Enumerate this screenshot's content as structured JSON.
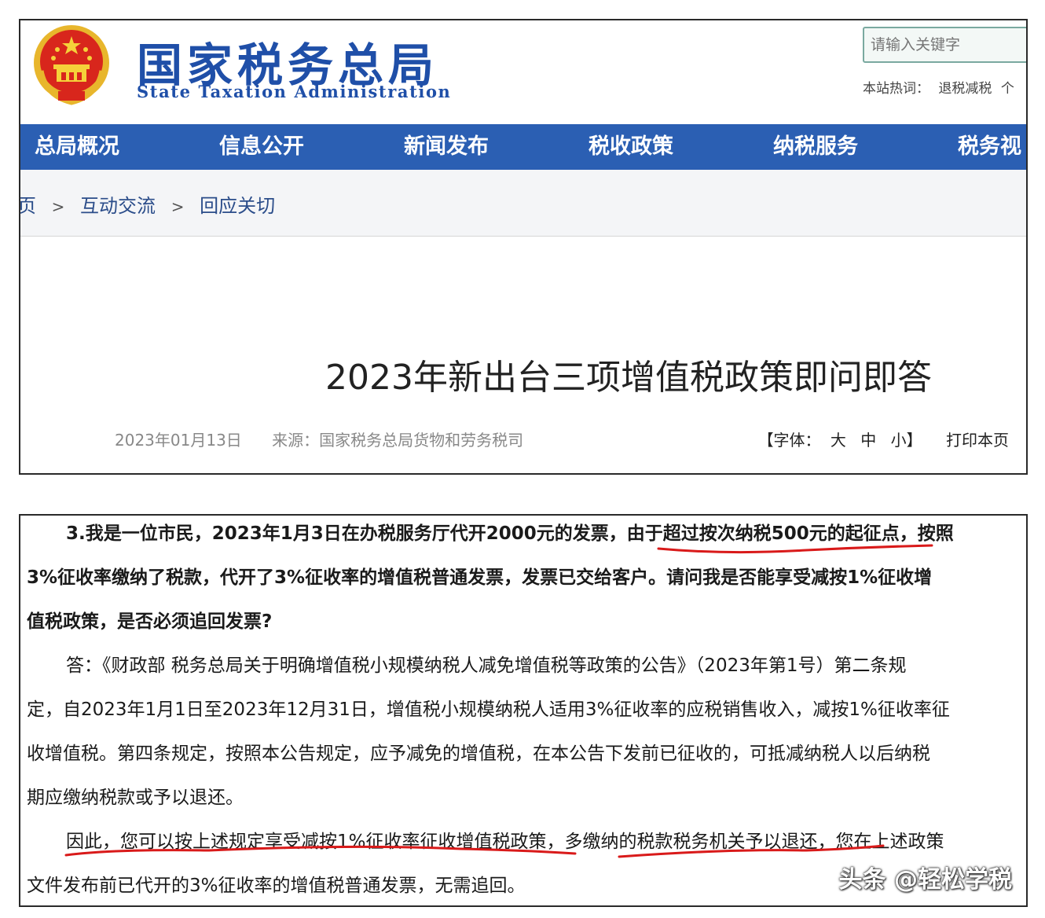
{
  "header": {
    "site_title": "国家税务总局",
    "site_subtitle": "State Taxation Administration",
    "search_placeholder": "请输入关键字",
    "hot_words_label": "本站热词：",
    "hot_words": [
      "退税减税",
      "个"
    ]
  },
  "nav": {
    "items": [
      "总局概况",
      "信息公开",
      "新闻发布",
      "税收政策",
      "纳税服务",
      "税务视"
    ]
  },
  "breadcrumb": {
    "items": [
      "页",
      "互动交流",
      "回应关切"
    ],
    "separator": ">"
  },
  "article": {
    "title": "2023年新出台三项增值税政策即问即答",
    "date": "2023年01月13日",
    "source": "来源：国家税务总局货物和劳务税司",
    "font_label": "【字体：",
    "font_large": "大",
    "font_medium": "中",
    "font_small": "小】",
    "print_label": "打印本页"
  },
  "qa": {
    "lines": [
      "3.我是一位市民，2023年1月3日在办税服务厅代开2000元的发票，由于超过按次纳税500元的起征点，按照",
      "3%征收率缴纳了税款，代开了3%征收率的增值税普通发票，发票已交给客户。请问我是否能享受减按1%征收增",
      "值税政策，是否必须追回发票?",
      "答：《财政部 税务总局关于明确增值税小规模纳税人减免增值税等政策的公告》（2023年第1号）第二条规",
      "定，自2023年1月1日至2023年12月31日，增值税小规模纳税人适用3%征收率的应税销售收入，减按1%征收率征",
      "收增值税。第四条规定，按照本公告规定，应予减免的增值税，在本公告下发前已征收的，可抵减纳税人以后纳税",
      "期应缴纳税款或予以退还。",
      "因此，您可以按上述规定享受减按1%征收率征收增值税政策，多缴纳的税款税务机关予以退还，您在上述政策",
      "文件发布前已代开的3%征收率的增值税普通发票，无需追回。"
    ]
  },
  "watermark": "头条 @轻松学税",
  "colors": {
    "brand_blue": "#1f4fa8",
    "nav_blue": "#2b5fb3",
    "annotation_red": "#d91a1a"
  }
}
